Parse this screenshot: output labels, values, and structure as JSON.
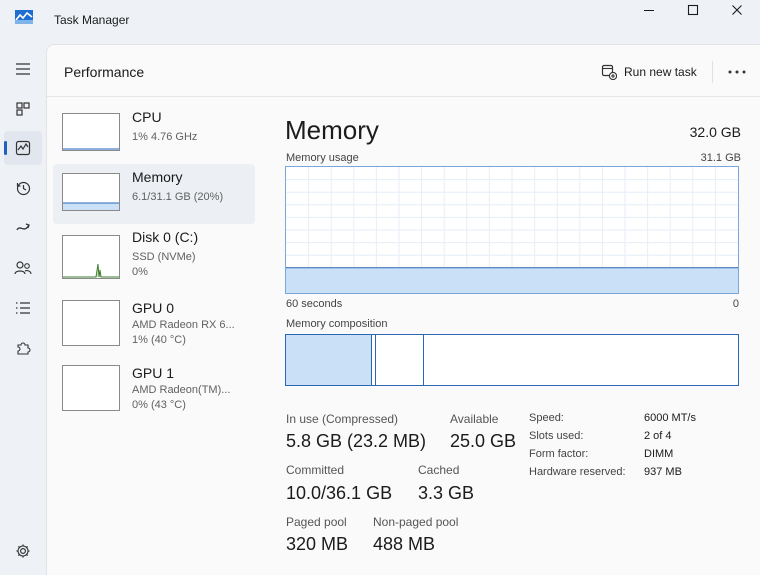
{
  "window": {
    "title": "Task Manager"
  },
  "header": {
    "title": "Performance",
    "run_new_task": "Run new task"
  },
  "sidebar": [
    {
      "name": "CPU",
      "line1": "1%  4.76 GHz",
      "line2": ""
    },
    {
      "name": "Memory",
      "line1": "6.1/31.1 GB (20%)",
      "line2": ""
    },
    {
      "name": "Disk 0 (C:)",
      "line1": "SSD (NVMe)",
      "line2": "0%"
    },
    {
      "name": "GPU 0",
      "line1": "AMD Radeon RX 6...",
      "line2": "1%  (40 °C)"
    },
    {
      "name": "GPU 1",
      "line1": "AMD Radeon(TM)...",
      "line2": "0%  (43 °C)"
    }
  ],
  "main": {
    "title": "Memory",
    "total": "32.0 GB",
    "usage_label": "Memory usage",
    "usage_max": "31.1 GB",
    "time_left": "60 seconds",
    "time_right": "0",
    "composition_label": "Memory composition",
    "composition": {
      "in_use_fraction": 0.19,
      "modified_fraction": 0.01,
      "standby_fraction": 0.105
    },
    "usage_level_fraction": 0.2,
    "stats": {
      "in_use_label": "In use (Compressed)",
      "in_use_value": "5.8 GB (23.2 MB)",
      "available_label": "Available",
      "available_value": "25.0 GB",
      "committed_label": "Committed",
      "committed_value": "10.0/36.1 GB",
      "cached_label": "Cached",
      "cached_value": "3.3 GB",
      "paged_label": "Paged pool",
      "paged_value": "320 MB",
      "nonpaged_label": "Non-paged pool",
      "nonpaged_value": "488 MB"
    },
    "details": [
      {
        "label": "Speed:",
        "value": "6000 MT/s"
      },
      {
        "label": "Slots used:",
        "value": "2 of 4"
      },
      {
        "label": "Form factor:",
        "value": "DIMM"
      },
      {
        "label": "Hardware reserved:",
        "value": "937 MB"
      }
    ]
  },
  "colors": {
    "accent": "#1f5fbf",
    "memory_fill": "#c9e0f7",
    "memory_line": "#2b67b5",
    "disk_line": "#3a7d2c"
  }
}
